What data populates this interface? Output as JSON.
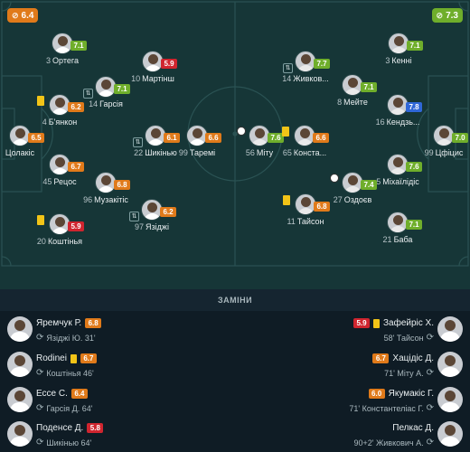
{
  "team_ratings": {
    "home": "6.4",
    "away": "7.3"
  },
  "home_players": [
    {
      "num": "3",
      "name": "Ортега",
      "rating": "7.1",
      "color": "green"
    },
    {
      "num": "10",
      "name": "Мартінш",
      "rating": "5.9",
      "color": "red"
    },
    {
      "num": "14",
      "name": "Гарсія",
      "rating": "7.1",
      "color": "green"
    },
    {
      "num": "4",
      "name": "Б'янкон",
      "rating": "6.2",
      "color": "orange"
    },
    {
      "num": "",
      "name": "Цолакіс",
      "rating": "6.5",
      "color": "orange"
    },
    {
      "num": "22",
      "name": "Шикінью",
      "rating": "6.1",
      "color": "orange"
    },
    {
      "num": "99",
      "name": "Таремі",
      "rating": "6.6",
      "color": "orange"
    },
    {
      "num": "45",
      "name": "Рецос",
      "rating": "6.7",
      "color": "orange"
    },
    {
      "num": "96",
      "name": "Музакітіс",
      "rating": "6.8",
      "color": "orange"
    },
    {
      "num": "97",
      "name": "Язіджі",
      "rating": "6.2",
      "color": "orange"
    },
    {
      "num": "20",
      "name": "Коштінья",
      "rating": "5.9",
      "color": "red"
    }
  ],
  "away_players": [
    {
      "num": "3",
      "name": "Кенні",
      "rating": "7.1",
      "color": "green"
    },
    {
      "num": "14",
      "name": "Живков...",
      "rating": "7.7",
      "color": "green"
    },
    {
      "num": "8",
      "name": "Мейте",
      "rating": "7.1",
      "color": "green"
    },
    {
      "num": "16",
      "name": "Кендзь...",
      "rating": "7.8",
      "color": "blue"
    },
    {
      "num": "56",
      "name": "Міту",
      "rating": "7.6",
      "color": "green"
    },
    {
      "num": "65",
      "name": "Конста...",
      "rating": "6.6",
      "color": "orange"
    },
    {
      "num": "99",
      "name": "Цфіцис",
      "rating": "7.0",
      "color": "green"
    },
    {
      "num": "5",
      "name": "Міхаїлідіс",
      "rating": "7.6",
      "color": "green"
    },
    {
      "num": "27",
      "name": "Оздоєв",
      "rating": "7.4",
      "color": "green"
    },
    {
      "num": "11",
      "name": "Тайсон",
      "rating": "6.8",
      "color": "orange"
    },
    {
      "num": "21",
      "name": "Баба",
      "rating": "7.1",
      "color": "green"
    }
  ],
  "subs": {
    "title": "ЗАМІНИ",
    "home": [
      {
        "name": "Яремчук Р.",
        "rating": "6.8",
        "color": "orange",
        "detail": "Язіджі Ю. 31'"
      },
      {
        "name": "Rodinei",
        "rating": "6.7",
        "color": "orange",
        "detail": "Коштінья 46'"
      },
      {
        "name": "Ессе С.",
        "rating": "6.4",
        "color": "orange",
        "detail": "Гарсія Д. 64'"
      },
      {
        "name": "Поденсе Д.",
        "rating": "5.8",
        "color": "red",
        "detail": "Шикінью 64'"
      }
    ],
    "away": [
      {
        "name": "Зафейріс Х.",
        "rating": "5.9",
        "color": "red",
        "detail": "58' Тайсон"
      },
      {
        "name": "Хацідіс Д.",
        "rating": "6.7",
        "color": "orange",
        "detail": "71' Міту А."
      },
      {
        "name": "Якумакіс Г.",
        "rating": "6.0",
        "color": "orange",
        "detail": "71' Константеліас Г."
      },
      {
        "name": "Пелкас Д.",
        "rating": "",
        "color": "",
        "detail": "90+2' Живкович А."
      }
    ]
  },
  "colors": {
    "green": "#6fae2b",
    "orange": "#e07a1a",
    "red": "#d0252f",
    "blue": "#2f67d8",
    "pitch": "#163637"
  }
}
